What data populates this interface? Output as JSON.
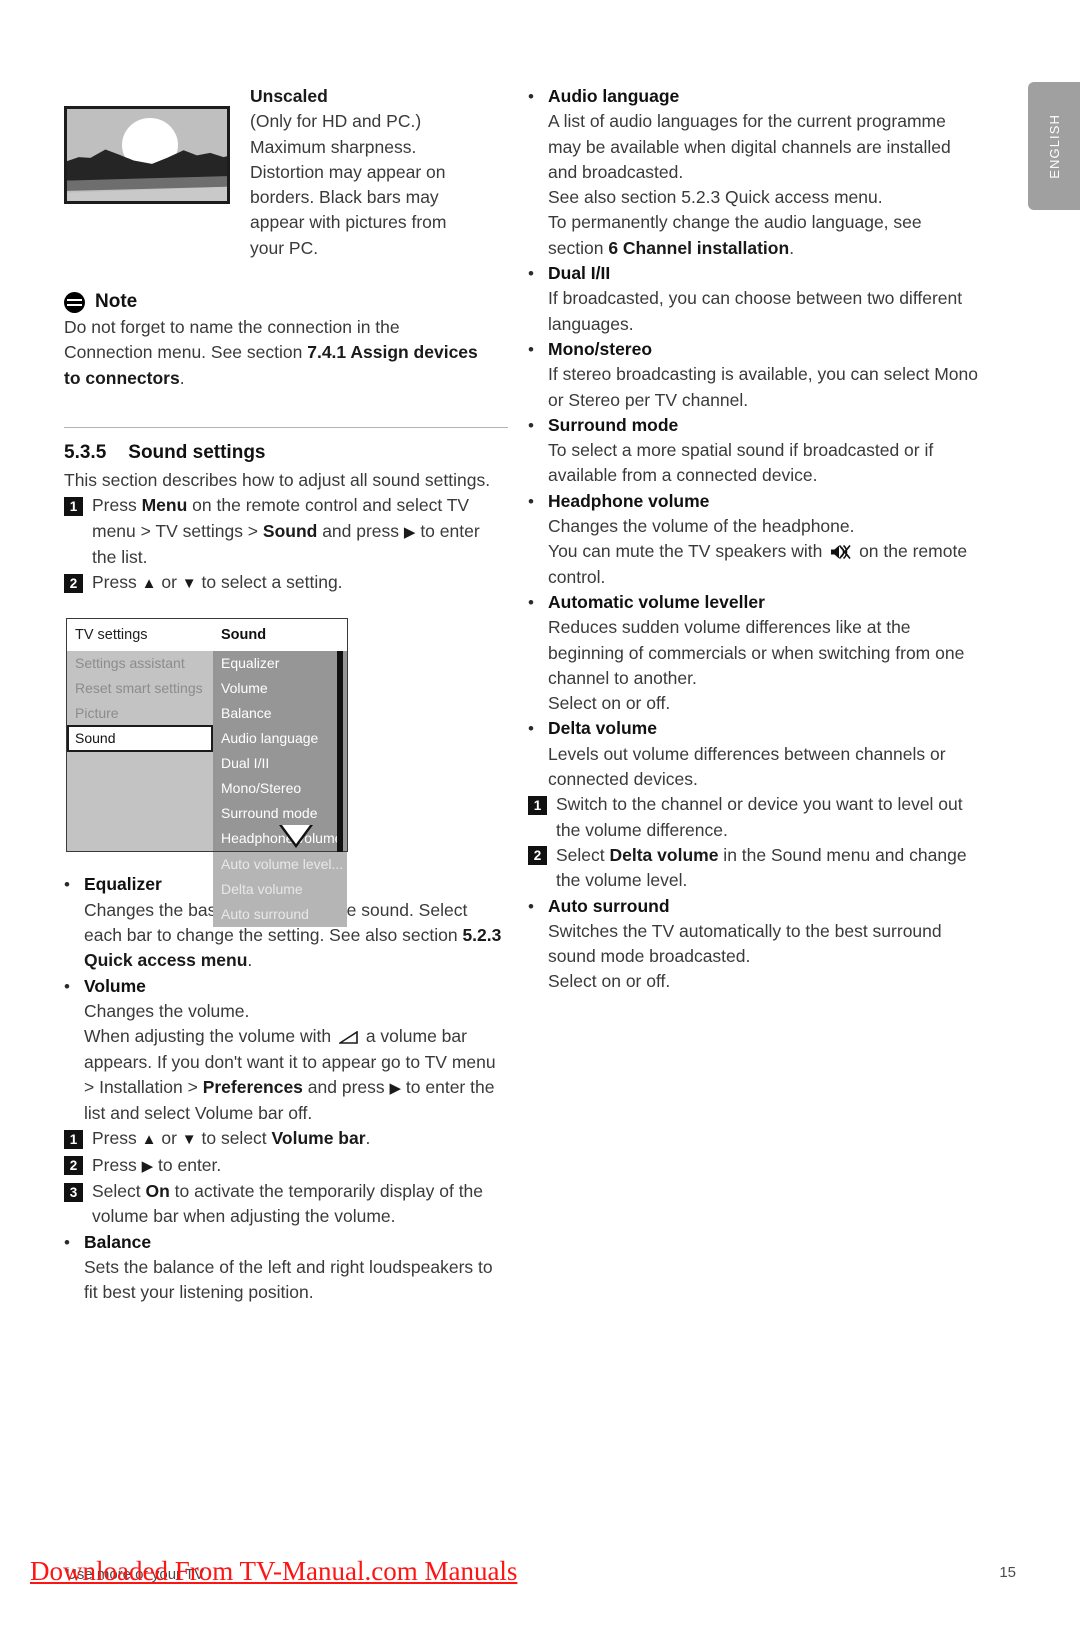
{
  "lang_tab": {
    "label": "ENGLISH"
  },
  "left_column": {
    "picture_block": {
      "image_name": "tv-unscaled-preview",
      "heading": "Unscaled",
      "lines": [
        "(Only for HD and PC.)",
        "Maximum sharpness.",
        "Distortion may appear on",
        "borders. Black bars may",
        "appear with pictures from",
        "your PC."
      ]
    },
    "note": {
      "title": "Note",
      "icon": "note-icon",
      "line1_a": "Do not forget to name the connection in the",
      "line2_a": "Connection menu. See section ",
      "line2_bold": "7.4.1 Assign devices",
      "line3_bold": "to connectors",
      "line3_b": "."
    },
    "section": {
      "number": "5.3.5",
      "title": "Sound settings",
      "intro": "This section describes how to adjust all sound settings.",
      "steps": [
        {
          "num": "1",
          "parts": [
            {
              "t": "Press ",
              "b": false
            },
            {
              "t": "Menu",
              "b": true
            },
            {
              "t": " on the remote control and select TV menu > TV settings > ",
              "b": false
            },
            {
              "t": "Sound",
              "b": true
            },
            {
              "t": " and press ",
              "b": false
            },
            {
              "t": "▶",
              "b": false
            },
            {
              "t": " to enter the list.",
              "b": false
            }
          ]
        },
        {
          "num": "2",
          "parts": [
            {
              "t": "Press ",
              "b": false
            },
            {
              "t": "▲",
              "b": false
            },
            {
              "t": " or ",
              "b": false
            },
            {
              "t": "▼",
              "b": false
            },
            {
              "t": " to select a setting.",
              "b": false
            }
          ]
        }
      ]
    },
    "menu": {
      "header_left": "TV settings",
      "header_right": "Sound",
      "left_items": [
        {
          "label": "Settings assistant",
          "selected": false
        },
        {
          "label": "Reset smart settings",
          "selected": false
        },
        {
          "label": "Picture",
          "selected": false
        },
        {
          "label": "Sound",
          "selected": true
        },
        {
          "label": "",
          "selected": false
        },
        {
          "label": "",
          "selected": false
        },
        {
          "label": "",
          "selected": false
        },
        {
          "label": "",
          "selected": false
        }
      ],
      "right_items": [
        {
          "label": "Equalizer",
          "dim": false
        },
        {
          "label": "Volume",
          "dim": false
        },
        {
          "label": "Balance",
          "dim": false
        },
        {
          "label": "Audio language",
          "dim": false
        },
        {
          "label": "Dual I/II",
          "dim": false
        },
        {
          "label": "Mono/Stereo",
          "dim": false
        },
        {
          "label": "Surround mode",
          "dim": false
        },
        {
          "label": "Headphone volume",
          "dim": false
        },
        {
          "label": "Auto volume level...",
          "dim": true
        },
        {
          "label": "Delta volume",
          "dim": true
        },
        {
          "label": "Auto surround",
          "dim": true
        }
      ],
      "scroll_arrow": "scroll-down-arrow"
    },
    "bullets": [
      {
        "title": "Equalizer",
        "body_parts": [
          {
            "t": "Changes the bass and treble of the sound. Select each bar to change the setting. See also section ",
            "b": false
          },
          {
            "t": "5.2.3 Quick access menu",
            "b": true
          },
          {
            "t": ".",
            "b": false
          }
        ]
      },
      {
        "title": "Volume",
        "body_parts": [
          {
            "t": "Changes the volume.",
            "b": false
          },
          {
            "t": "\nWhen adjusting the volume with ",
            "b": false
          },
          {
            "t": "[volume-icon]",
            "b": false
          },
          {
            "t": " a volume bar appears. If you don't want it to appear go to TV menu > Installation > ",
            "b": false
          },
          {
            "t": "Preferences",
            "b": true
          },
          {
            "t": " and press ",
            "b": false
          },
          {
            "t": "▶",
            "b": false
          },
          {
            "t": " to enter the list and select Volume bar off.",
            "b": false
          }
        ],
        "steps": [
          {
            "num": "1",
            "parts": [
              {
                "t": "Press ",
                "b": false
              },
              {
                "t": "▲",
                "b": false
              },
              {
                "t": " or ",
                "b": false
              },
              {
                "t": "▼",
                "b": false
              },
              {
                "t": " to select ",
                "b": false
              },
              {
                "t": "Volume bar",
                "b": true
              },
              {
                "t": ".",
                "b": false
              }
            ]
          },
          {
            "num": "2",
            "parts": [
              {
                "t": "Press ",
                "b": false
              },
              {
                "t": "▶",
                "b": false
              },
              {
                "t": " to enter.",
                "b": false
              }
            ]
          },
          {
            "num": "3",
            "parts": [
              {
                "t": "Select ",
                "b": false
              },
              {
                "t": "On",
                "b": true
              },
              {
                "t": " to activate the temporarily display of the volume bar when adjusting the volume.",
                "b": false
              }
            ]
          }
        ]
      },
      {
        "title": "Balance",
        "body_parts": [
          {
            "t": "Sets the balance of the left and right loudspeakers to fit best your listening position.",
            "b": false
          }
        ]
      }
    ]
  },
  "right_column": {
    "bullets": [
      {
        "title": "Audio language",
        "body_parts": [
          {
            "t": "A list of audio languages for the current programme may be available when digital channels are installed and broadcasted.",
            "b": false
          },
          {
            "t": "\nSee also section 5.2.3 Quick access menu.",
            "b": false
          },
          {
            "t": "\nTo permanently change the audio language, see section ",
            "b": false
          },
          {
            "t": "6 Channel installation",
            "b": true
          },
          {
            "t": ".",
            "b": false
          }
        ]
      },
      {
        "title": "Dual I/II",
        "body_parts": [
          {
            "t": "If broadcasted, you can choose between two different languages.",
            "b": false
          }
        ]
      },
      {
        "title": "Mono/stereo",
        "body_parts": [
          {
            "t": "If stereo broadcasting is available, you can select Mono or Stereo per TV channel.",
            "b": false
          }
        ]
      },
      {
        "title": "Surround mode",
        "body_parts": [
          {
            "t": "To select a more spatial sound if broadcasted or if available from a connected device.",
            "b": false
          }
        ]
      },
      {
        "title": "Headphone volume",
        "body_parts": [
          {
            "t": "Changes the volume of the headphone.",
            "b": false
          },
          {
            "t": "\nYou can mute the TV speakers with ",
            "b": false
          },
          {
            "t": "[mute-icon]",
            "b": false
          },
          {
            "t": " on the remote control.",
            "b": false
          }
        ]
      },
      {
        "title": "Automatic volume leveller",
        "body_parts": [
          {
            "t": "Reduces sudden volume differences like at the beginning of commercials or when switching from one channel to another.",
            "b": false
          },
          {
            "t": "\nSelect on or off.",
            "b": false
          }
        ]
      },
      {
        "title": "Delta volume",
        "body_parts": [
          {
            "t": "Levels out volume differences between channels or connected devices.",
            "b": false
          }
        ],
        "steps": [
          {
            "num": "1",
            "parts": [
              {
                "t": "Switch to the channel or device you want to level out the volume difference.",
                "b": false
              }
            ]
          },
          {
            "num": "2",
            "parts": [
              {
                "t": "Select ",
                "b": false
              },
              {
                "t": "Delta volume",
                "b": true
              },
              {
                "t": " in the Sound menu and change the volume level.",
                "b": false
              }
            ]
          }
        ]
      },
      {
        "title": "Auto surround",
        "body_parts": [
          {
            "t": "Switches the TV automatically to the best surround sound mode broadcasted.",
            "b": false
          },
          {
            "t": "\nSelect on or off.",
            "b": false
          }
        ]
      }
    ]
  },
  "footer": {
    "watermark": "Downloaded From TV-Manual.com Manuals",
    "underlying_text": "Use more of your TV",
    "page_number": "15"
  }
}
